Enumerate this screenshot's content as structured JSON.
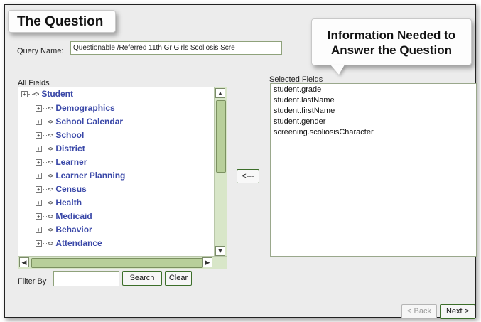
{
  "callouts": {
    "question": "The Question",
    "info_line1": "Information Needed to",
    "info_line2": "Answer the Question"
  },
  "query": {
    "label": "Query Name:",
    "value": "Questionable /Referred 11th Gr Girls Scoliosis Scre"
  },
  "all_fields": {
    "label": "All Fields",
    "root": "Student",
    "items": [
      "Demographics",
      "School Calendar",
      "School",
      "District",
      "Learner",
      "Learner Planning",
      "Census",
      "Health",
      "Medicaid",
      "Behavior",
      "Attendance"
    ]
  },
  "move_button": "<---",
  "selected_fields": {
    "label": "Selected Fields",
    "items": [
      "student.grade",
      "student.lastName",
      "student.firstName",
      "student.gender",
      "screening.scoliosisCharacter"
    ]
  },
  "filter": {
    "label": "Filter By",
    "value": "",
    "search_label": "Search",
    "clear_label": "Clear"
  },
  "nav": {
    "back_label": "< Back",
    "next_label": "Next >"
  }
}
